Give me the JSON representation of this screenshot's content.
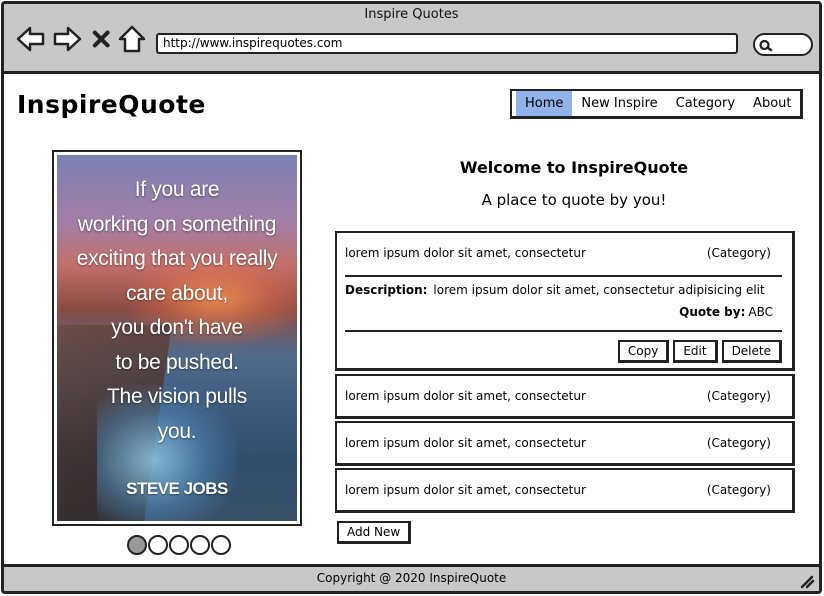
{
  "window": {
    "title": "Inspire Quotes",
    "url": "http://www.inspirequotes.com",
    "icons": [
      "back-arrow-icon",
      "forward-arrow-icon",
      "close-x-icon",
      "home-icon",
      "search-icon"
    ]
  },
  "header": {
    "logo": "InspireQuote",
    "nav": [
      {
        "label": "Home",
        "active": true
      },
      {
        "label": "New Inspire",
        "active": false
      },
      {
        "label": "Category",
        "active": false
      },
      {
        "label": "About",
        "active": false
      }
    ]
  },
  "hero": {
    "quote": "If you are\nworking on something\nexciting that you really\ncare about,\nyou don't have\nto be pushed.\nThe vision pulls\nyou.",
    "author": "STEVE JOBS",
    "carousel_active_index": 0,
    "carousel_count": 5
  },
  "main": {
    "welcome": "Welcome to InspireQuote",
    "subtitle": "A place to quote by you!",
    "quotes": [
      {
        "text": "lorem ipsum dolor sit amet, consectetur",
        "category": "(Category)",
        "description_label": "Description:",
        "description": "lorem ipsum dolor sit amet, consectetur adipisicing elit",
        "quote_by_label": "Quote by:",
        "quote_by": "ABC",
        "actions": {
          "copy": "Copy",
          "edit": "Edit",
          "delete": "Delete"
        }
      },
      {
        "text": "lorem ipsum dolor sit amet, consectetur",
        "category": "(Category)"
      },
      {
        "text": "lorem ipsum dolor sit amet, consectetur",
        "category": "(Category)"
      },
      {
        "text": "lorem ipsum dolor sit amet, consectetur",
        "category": "(Category)"
      }
    ],
    "add_new": "Add New"
  },
  "footer": {
    "copyright": "Copyright @ 2020 InspireQuote"
  },
  "colors": {
    "chrome": "#c8c8c8",
    "active_nav": "#8fb3ea",
    "border": "#222222"
  }
}
